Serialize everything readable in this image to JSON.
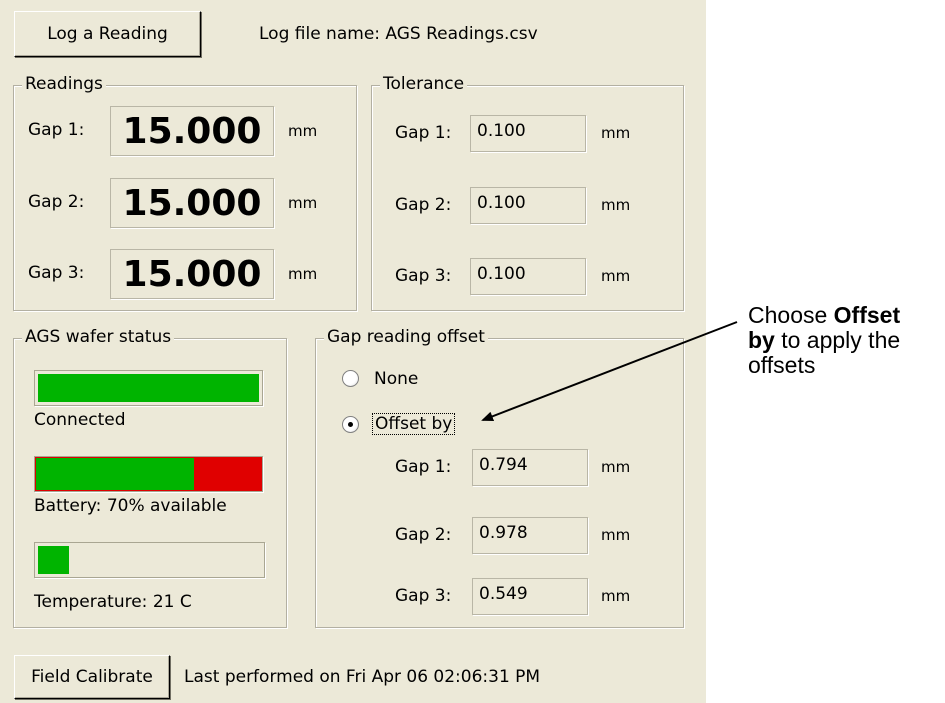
{
  "toolbar": {
    "log_button_label": "Log a Reading",
    "log_file_label": "Log file name:  AGS Readings.csv"
  },
  "readings": {
    "title": "Readings",
    "rows": [
      {
        "label": "Gap 1:",
        "value": "15.000",
        "unit": "mm"
      },
      {
        "label": "Gap 2:",
        "value": "15.000",
        "unit": "mm"
      },
      {
        "label": "Gap 3:",
        "value": "15.000",
        "unit": "mm"
      }
    ]
  },
  "tolerance": {
    "title": "Tolerance",
    "rows": [
      {
        "label": "Gap 1:",
        "value": "0.100",
        "unit": "mm"
      },
      {
        "label": "Gap 2:",
        "value": "0.100",
        "unit": "mm"
      },
      {
        "label": "Gap 3:",
        "value": "0.100",
        "unit": "mm"
      }
    ]
  },
  "status": {
    "title": "AGS wafer status",
    "connection": {
      "label": "Connected",
      "level": 1.0,
      "color": "#00b400"
    },
    "battery": {
      "label": "Battery: 70% available",
      "level": 0.7,
      "fill_color": "#00b400",
      "empty_color": "#e00000"
    },
    "temperature": {
      "label": "Temperature: 21 C",
      "level": 0.14,
      "color": "#00b400"
    }
  },
  "offset": {
    "title": "Gap reading offset",
    "options": [
      {
        "label": "None",
        "selected": false
      },
      {
        "label": "Offset by",
        "selected": true
      }
    ],
    "rows": [
      {
        "label": "Gap 1:",
        "value": "0.794",
        "unit": "mm"
      },
      {
        "label": "Gap 2:",
        "value": "0.978",
        "unit": "mm"
      },
      {
        "label": "Gap 3:",
        "value": "0.549",
        "unit": "mm"
      }
    ]
  },
  "footer": {
    "calibrate_label": "Field Calibrate",
    "last_performed": "Last performed on Fri Apr 06 02:06:31 PM"
  },
  "annotation": {
    "prefix": "Choose ",
    "bold1": "Offset",
    "bold2": "by",
    "suffix": " to apply the offsets"
  }
}
